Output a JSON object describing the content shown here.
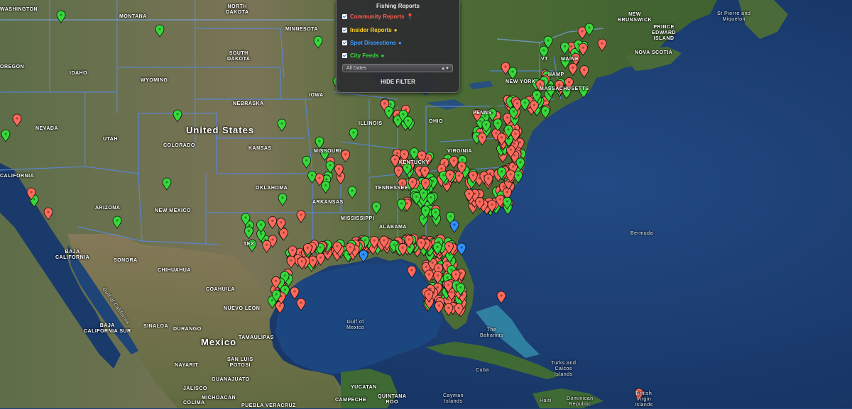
{
  "map": {
    "country_labels": {
      "united_states": "United States",
      "mexico": "Mexico"
    },
    "state_labels": {
      "washington": "WASHINGTON",
      "montana": "MONTANA",
      "north_dakota": "NORTH\nDAKOTA",
      "minnesota": "MINNESOTA",
      "south_dakota": "SOUTH\nDAKOTA",
      "oregon": "OREGON",
      "idaho": "IDAHO",
      "wyoming": "WYOMING",
      "nebraska": "NEBRASKA",
      "iowa": "IOWA",
      "nevada": "NEVADA",
      "utah": "UTAH",
      "colorado": "COLORADO",
      "kansas": "KANSAS",
      "missouri": "MISSOURI",
      "illinois": "ILLINOIS",
      "ohio": "OHIO",
      "pennsylvania": "PENNS",
      "virginia": "VIRGINIA",
      "kentucky": "KENTUCKY",
      "tennessee": "TENNESSEE",
      "california": "CALIFORNIA",
      "arizona": "ARIZONA",
      "new_mexico": "NEW MEXICO",
      "oklahoma": "OKLAHOMA",
      "arkansas": "ARKANSAS",
      "mississippi": "MISSISSIPPI",
      "alabama": "ALABAMA",
      "texas": "TEX",
      "new_york": "NEW YORK",
      "massachusetts": "MASSACHUSETTS",
      "new_hampshire": "HAMP",
      "vermont": "VT",
      "maine": "MAINE"
    },
    "other_labels": {
      "new_brunswick": "NEW\nBRUNSWICK",
      "pei": "PRINCE\nEDWARD\nISLAND",
      "nova_scotia": "NOVA SCOTIA",
      "st_pierre": "St Pierre and\nMiquelon",
      "bermuda": "Bermuda",
      "gulf_of_mexico": "Gulf of\nMexico",
      "gulf_of_california": "Gulf of California",
      "bahamas": "The\nBahamas",
      "cuba": "Cuba",
      "turks_caicos": "Turks and\nCaicos\nIslands",
      "cayman": "Cayman\nIslands",
      "haiti": "Haiti",
      "dominican": "Dominican\nRepublic",
      "virgin": "British\nVirgin\nIslands",
      "baja_california": "BAJA\nCALIFORNIA",
      "baja_california_sur": "BAJA\nCALIFORNIA SUR",
      "sonora": "SONORA",
      "chihuahua": "CHIHUAHUA",
      "coahuila": "COAHUILA",
      "nuevo_leon": "NUEVO LEON",
      "sinaloa": "SINALOA",
      "durango": "DURANGO",
      "tamaulipas": "TAMAULIPAS",
      "nayarit": "NAYARIT",
      "san_luis_potosi": "SAN LUIS\nPOTOSI",
      "guanajuato": "GUANAJUATO",
      "jalisco": "JALISCO",
      "colima": "COLIMA",
      "michoacan": "MICHOACAN",
      "yucatan": "YUCATAN",
      "campeche": "CAMPECHE",
      "quintana_roo": "QUINTANA\nROO",
      "puebla_veracruz": "PUEBLA VERACRUZ"
    },
    "colors": {
      "community": "#ff6a5c",
      "insider": "#ffd21f",
      "spot": "#2f8fff",
      "city": "#36d93a",
      "ocean": "#1d3f73",
      "land": "#4d6a37"
    }
  },
  "filter": {
    "title": "Fishing Reports",
    "options": [
      {
        "label": "Community Reports",
        "checked": true,
        "color": "#ff5a4e",
        "icon": "map-pin-icon"
      },
      {
        "label": "Insider Reports",
        "checked": true,
        "color": "#ffd21f",
        "icon": "map-pin-icon"
      },
      {
        "label": "Spot Dissections",
        "checked": true,
        "color": "#3d9bff",
        "icon": "map-pin-icon"
      },
      {
        "label": "City Feeds",
        "checked": true,
        "color": "#39d83c",
        "icon": "map-pin-icon"
      }
    ],
    "date_select": "All Dates",
    "hide_button": "HIDE FILTER"
  }
}
